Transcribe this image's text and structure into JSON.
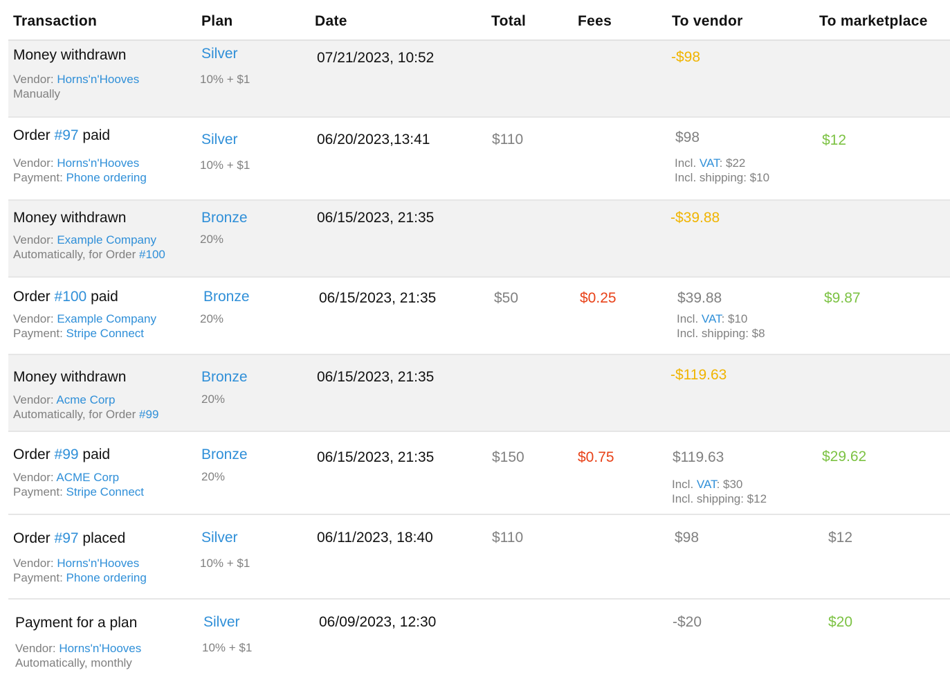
{
  "headers": {
    "transaction": "Transaction",
    "plan": "Plan",
    "date": "Date",
    "total": "Total",
    "fees": "Fees",
    "to_vendor": "To vendor",
    "to_marketplace": "To marketplace"
  },
  "rows": [
    {
      "title_pre": "Money withdrawn",
      "title_link": "",
      "title_post": "",
      "vendor_label": "Vendor: ",
      "vendor": "Horns'n'Hooves",
      "detail_pre": "Manually",
      "detail_label": "",
      "detail_link": "",
      "plan": "Silver",
      "rate": "10% + $1",
      "date": "07/21/2023, 10:52",
      "total": "",
      "fees": "",
      "to_vendor": "-$98",
      "vat_label": "",
      "vat_link": "",
      "vat_value": "",
      "shipping": "",
      "to_marketplace": ""
    },
    {
      "title_pre": "Order ",
      "title_link": "#97",
      "title_post": " paid",
      "vendor_label": "Vendor: ",
      "vendor": "Horns'n'Hooves",
      "detail_pre": "",
      "detail_label": "Payment: ",
      "detail_link": "Phone ordering",
      "plan": "Silver",
      "rate": "10% + $1",
      "date": "06/20/2023,13:41",
      "total": "$110",
      "fees": "",
      "to_vendor": "$98",
      "vat_label": "Incl. ",
      "vat_link": "VAT",
      "vat_value": ": $22",
      "shipping": "Incl. shipping: $10",
      "to_marketplace": "$12"
    },
    {
      "title_pre": "Money withdrawn",
      "title_link": "",
      "title_post": "",
      "vendor_label": "Vendor: ",
      "vendor": "Example Company",
      "detail_pre": "Automatically, for Order ",
      "detail_label": "",
      "detail_link": "#100",
      "plan": "Bronze",
      "rate": "20%",
      "date": "06/15/2023, 21:35",
      "total": "",
      "fees": "",
      "to_vendor": "-$39.88",
      "vat_label": "",
      "vat_link": "",
      "vat_value": "",
      "shipping": "",
      "to_marketplace": ""
    },
    {
      "title_pre": "Order ",
      "title_link": "#100",
      "title_post": " paid",
      "vendor_label": "Vendor: ",
      "vendor": "Example Company",
      "detail_pre": "",
      "detail_label": "Payment: ",
      "detail_link": "Stripe Connect",
      "plan": "Bronze",
      "rate": "20%",
      "date": "06/15/2023, 21:35",
      "total": "$50",
      "fees": "$0.25",
      "to_vendor": "$39.88",
      "vat_label": "Incl. ",
      "vat_link": "VAT",
      "vat_value": ": $10",
      "shipping": "Incl. shipping: $8",
      "to_marketplace": "$9.87"
    },
    {
      "title_pre": "Money withdrawn",
      "title_link": "",
      "title_post": "",
      "vendor_label": "Vendor: ",
      "vendor": "Acme Corp",
      "detail_pre": "Automatically, for Order ",
      "detail_label": "",
      "detail_link": "#99",
      "plan": "Bronze",
      "rate": "20%",
      "date": "06/15/2023, 21:35",
      "total": "",
      "fees": "",
      "to_vendor": "-$119.63",
      "vat_label": "",
      "vat_link": "",
      "vat_value": "",
      "shipping": "",
      "to_marketplace": ""
    },
    {
      "title_pre": "Order ",
      "title_link": "#99",
      "title_post": " paid",
      "vendor_label": "Vendor: ",
      "vendor": "ACME Corp",
      "detail_pre": "",
      "detail_label": "Payment: ",
      "detail_link": "Stripe Connect",
      "plan": "Bronze",
      "rate": "20%",
      "date": "06/15/2023, 21:35",
      "total": "$150",
      "fees": "$0.75",
      "to_vendor": "$119.63",
      "vat_label": "Incl. ",
      "vat_link": "VAT",
      "vat_value": ": $30",
      "shipping": "Incl. shipping: $12",
      "to_marketplace": "$29.62"
    },
    {
      "title_pre": "Order ",
      "title_link": "#97",
      "title_post": " placed",
      "vendor_label": "Vendor: ",
      "vendor": "Horns'n'Hooves",
      "detail_pre": "",
      "detail_label": "Payment: ",
      "detail_link": "Phone ordering",
      "plan": "Silver",
      "rate": "10% + $1",
      "date": "06/11/2023, 18:40",
      "total": "$110",
      "fees": "",
      "to_vendor": "$98",
      "vat_label": "",
      "vat_link": "",
      "vat_value": "",
      "shipping": "",
      "to_marketplace": "$12"
    },
    {
      "title_pre": "Payment for a plan",
      "title_link": "",
      "title_post": "",
      "vendor_label": "Vendor: ",
      "vendor": "Horns'n'Hooves",
      "detail_pre": "Automatically, monthly",
      "detail_label": "",
      "detail_link": "",
      "plan": "Silver",
      "rate": "10% + $1",
      "date": "06/09/2023, 12:30",
      "total": "",
      "fees": "",
      "to_vendor": "-$20",
      "vat_label": "",
      "vat_link": "",
      "vat_value": "",
      "shipping": "",
      "to_marketplace": "$20"
    }
  ],
  "colors": {
    "link": "#2f8fd8",
    "fee": "#e84118",
    "withdrawn": "#f0b400",
    "positive": "#7cc243",
    "neutral": "#808080"
  }
}
